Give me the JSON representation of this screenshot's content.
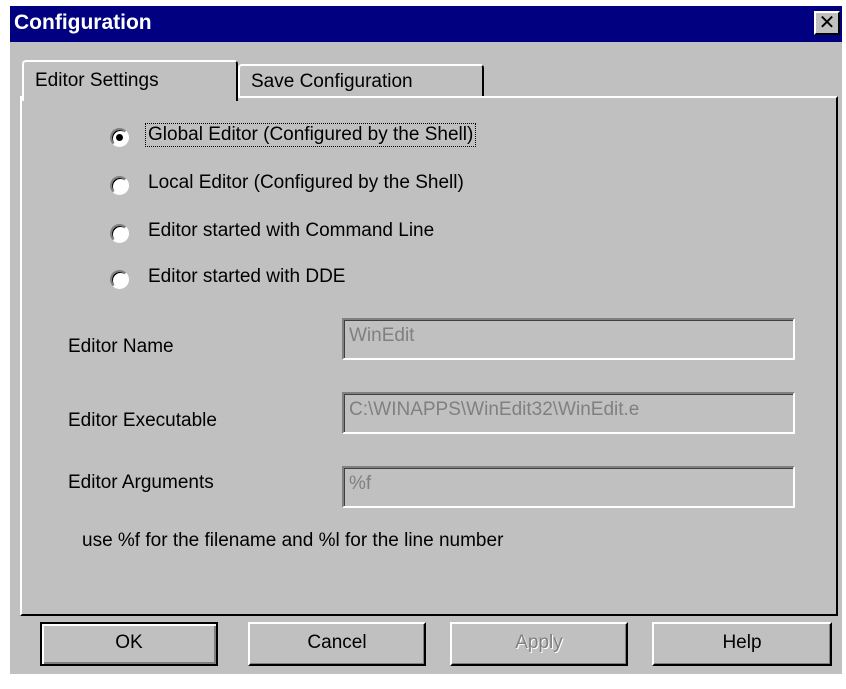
{
  "window": {
    "title": "Configuration",
    "close_glyph": "✕"
  },
  "tabs": [
    {
      "label": "Editor Settings",
      "active": true
    },
    {
      "label": "Save Configuration",
      "active": false
    }
  ],
  "editor_options": [
    {
      "label": "Global Editor (Configured by the Shell)",
      "selected": true
    },
    {
      "label": "Local Editor (Configured by the Shell)",
      "selected": false
    },
    {
      "label": "Editor started with Command Line",
      "selected": false
    },
    {
      "label": "Editor started with DDE",
      "selected": false
    }
  ],
  "fields": {
    "editor_name": {
      "label": "Editor Name",
      "value": "WinEdit"
    },
    "editor_executable": {
      "label": "Editor Executable",
      "value": "C:\\WINAPPS\\WinEdit32\\WinEdit.e"
    },
    "editor_arguments": {
      "label": "Editor Arguments",
      "value": "%f"
    }
  },
  "hint": "use %f for the filename and %l for the line number",
  "buttons": {
    "ok": "OK",
    "cancel": "Cancel",
    "apply": "Apply",
    "help": "Help"
  },
  "icons": {
    "close": "close-icon"
  }
}
